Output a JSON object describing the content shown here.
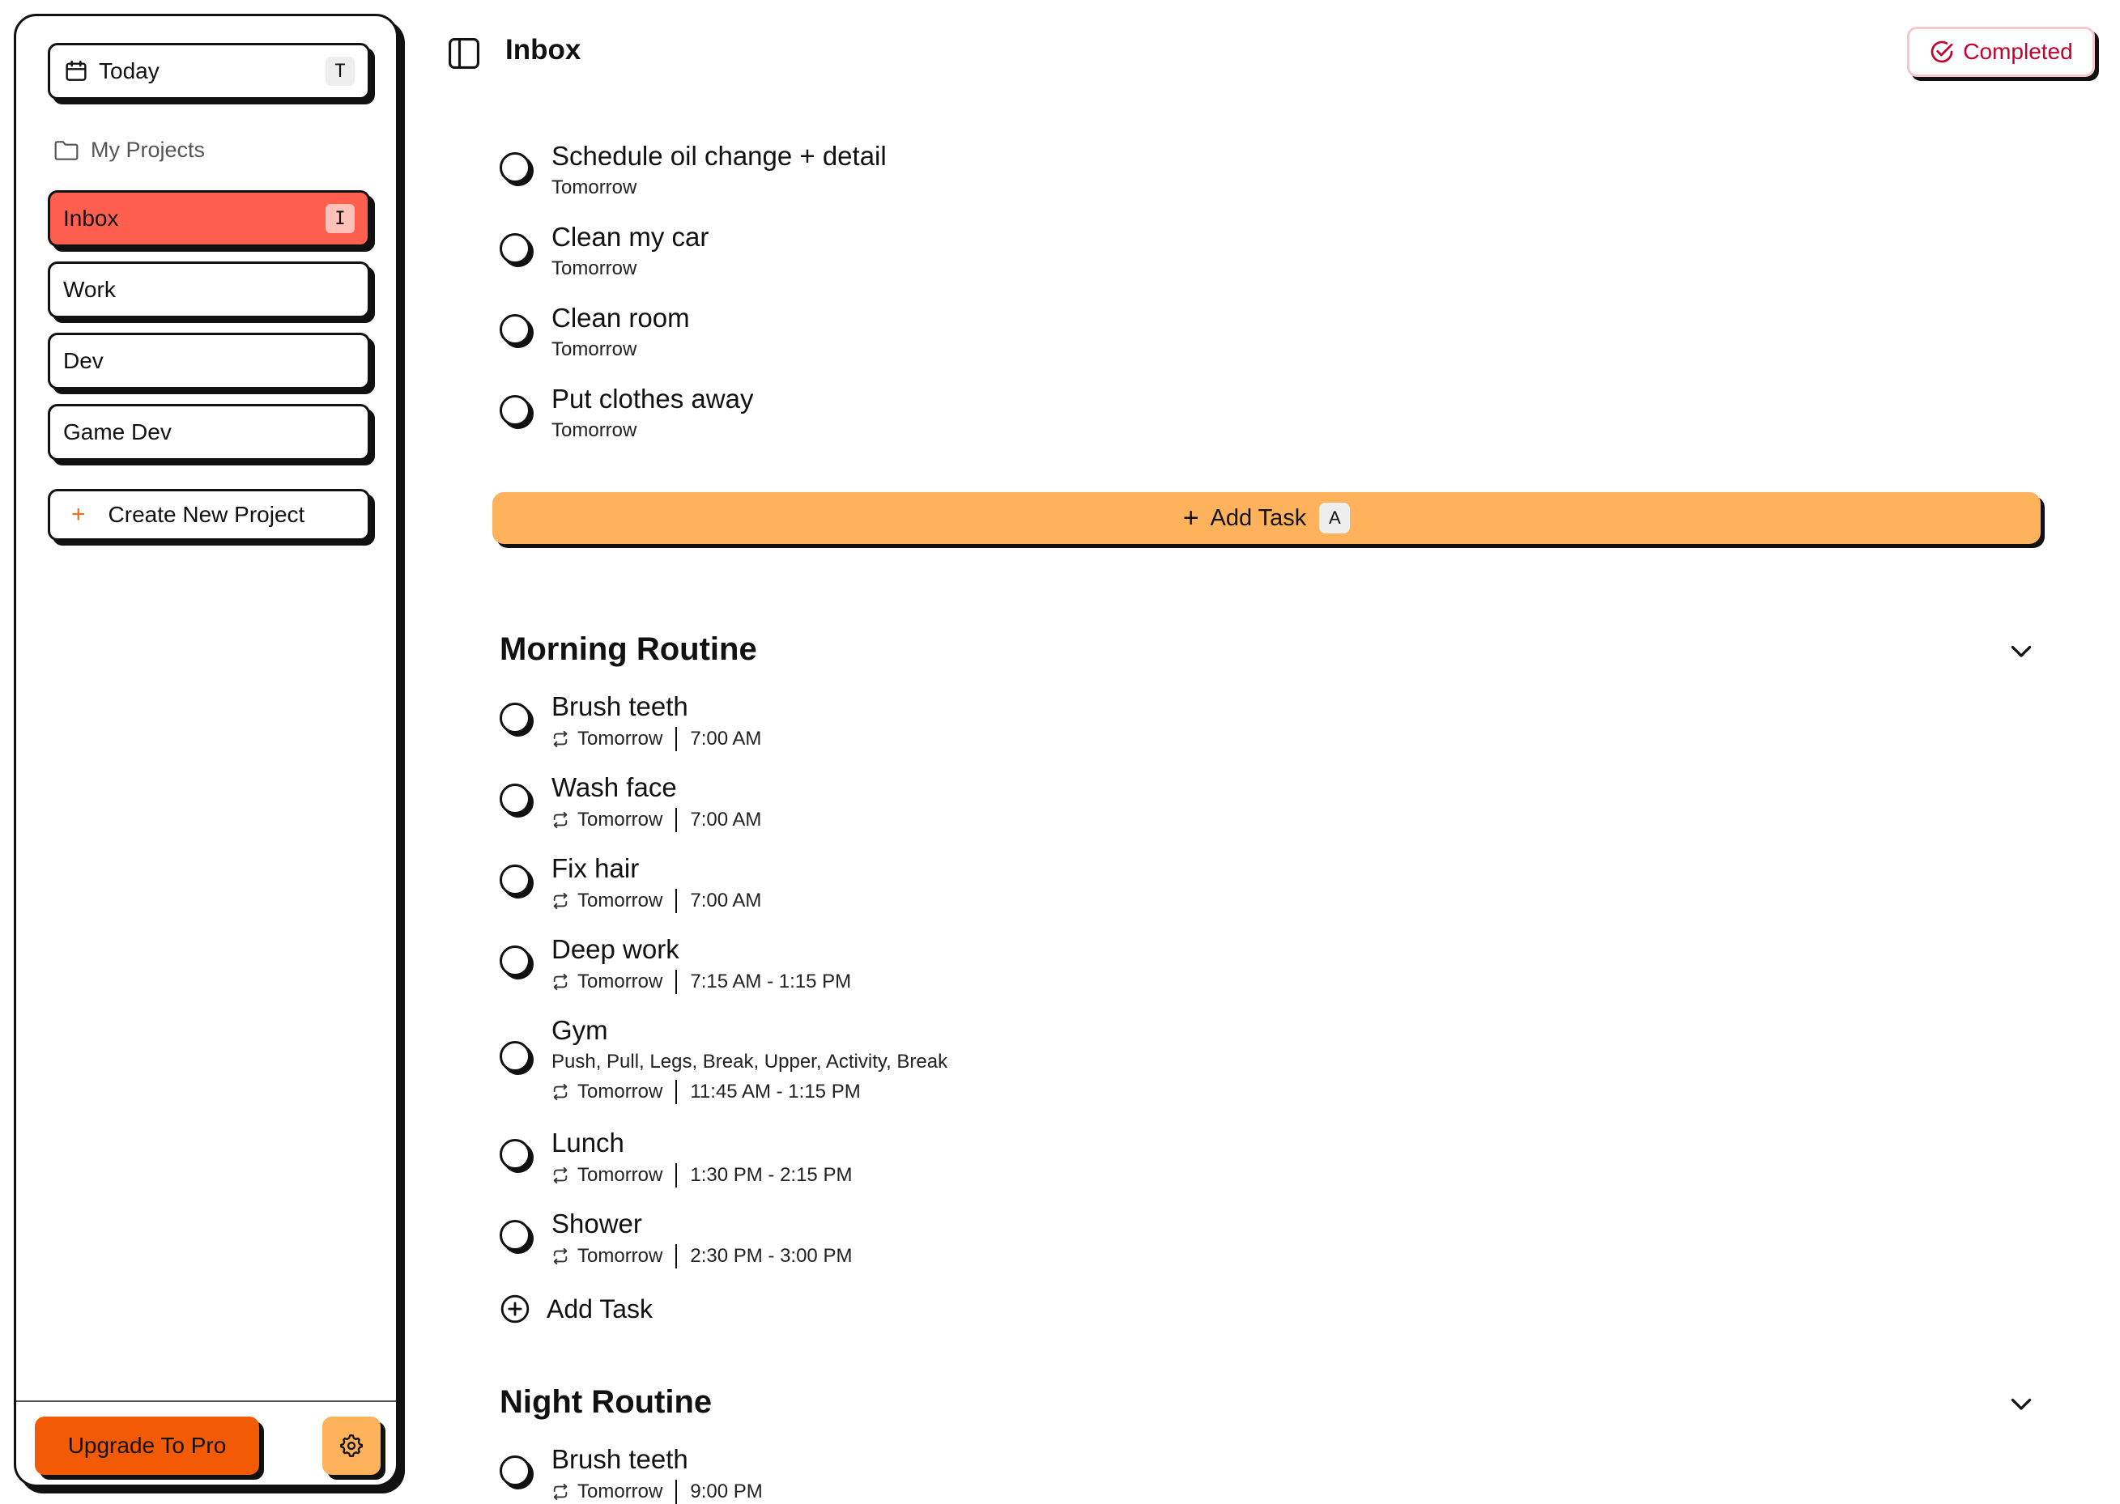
{
  "sidebar": {
    "today": {
      "label": "Today",
      "shortcut": "T",
      "icon": "calendar-icon"
    },
    "section_label": "My Projects",
    "projects": [
      {
        "label": "Inbox",
        "shortcut": "I",
        "active": true,
        "color": "#ff5f4e"
      },
      {
        "label": "Work"
      },
      {
        "label": "Dev"
      },
      {
        "label": "Game Dev"
      }
    ],
    "create_label": "Create New Project",
    "upgrade_label": "Upgrade To Pro",
    "upgrade_color": "#f35a06",
    "settings_icon": "gear-icon"
  },
  "header": {
    "title": "Inbox",
    "completed_label": "Completed",
    "completed_color": "#c3002f"
  },
  "inbox_tasks": [
    {
      "title": "Schedule oil change + detail",
      "due": "Tomorrow"
    },
    {
      "title": "Clean my car",
      "due": "Tomorrow"
    },
    {
      "title": "Clean room",
      "due": "Tomorrow"
    },
    {
      "title": "Put clothes away",
      "due": "Tomorrow"
    }
  ],
  "add_task": {
    "label": "Add Task",
    "shortcut": "A",
    "color": "#ffb25c"
  },
  "sections": [
    {
      "title": "Morning Routine",
      "tasks": [
        {
          "title": "Brush teeth",
          "due": "Tomorrow",
          "time": "7:00 AM"
        },
        {
          "title": "Wash face",
          "due": "Tomorrow",
          "time": "7:00 AM"
        },
        {
          "title": "Fix hair",
          "due": "Tomorrow",
          "time": "7:00 AM"
        },
        {
          "title": "Deep work",
          "due": "Tomorrow",
          "time": "7:15 AM - 1:15 PM"
        },
        {
          "title": "Gym",
          "description": "Push, Pull, Legs, Break, Upper, Activity, Break",
          "due": "Tomorrow",
          "time": "11:45 AM - 1:15 PM"
        },
        {
          "title": "Lunch",
          "due": "Tomorrow",
          "time": "1:30 PM - 2:15 PM"
        },
        {
          "title": "Shower",
          "due": "Tomorrow",
          "time": "2:30 PM - 3:00 PM"
        }
      ],
      "add_label": "Add Task"
    },
    {
      "title": "Night Routine",
      "tasks": [
        {
          "title": "Brush teeth",
          "due": "Tomorrow",
          "time": "9:00 PM"
        }
      ]
    }
  ]
}
